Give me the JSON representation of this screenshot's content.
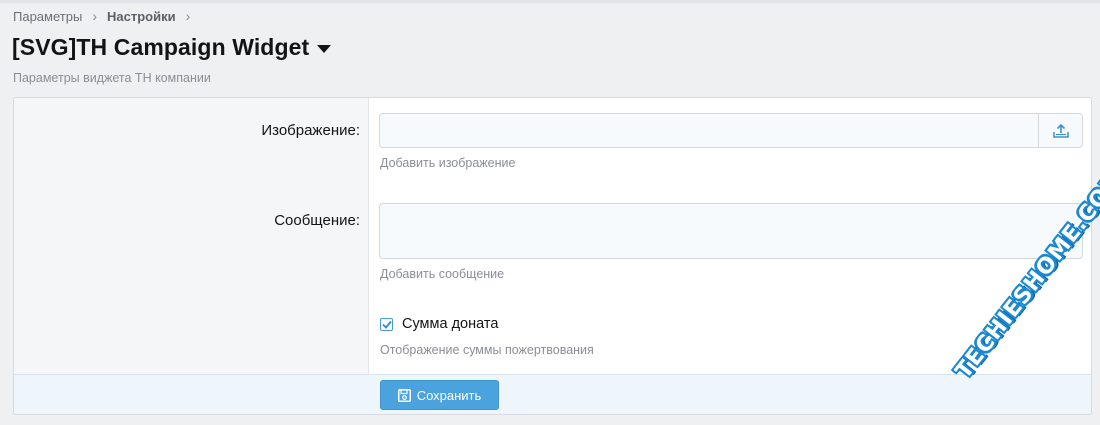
{
  "breadcrumb": {
    "items": [
      {
        "label": "Параметры"
      },
      {
        "label": "Настройки"
      }
    ]
  },
  "header": {
    "title": "[SVG]TH Campaign Widget",
    "description": "Параметры виджета TH компании"
  },
  "form": {
    "image": {
      "label": "Изображение:",
      "value": "",
      "hint": "Добавить изображение"
    },
    "message": {
      "label": "Сообщение:",
      "value": "",
      "hint": "Добавить сообщение"
    },
    "donation_sum": {
      "label": "Сумма доната",
      "checked": true,
      "hint": "Отображение суммы пожертвования"
    },
    "save_label": "Сохранить"
  },
  "watermark": {
    "text": "TECHIESHOME.COM"
  },
  "colors": {
    "accent": "#4aa3df",
    "page_bg": "#eff0f2",
    "watermark_blue": "#1b88d3"
  },
  "icons": {
    "breadcrumb_separator": "chevron-right-icon",
    "title_dropdown": "caret-down-icon",
    "upload": "upload-icon",
    "checkbox": "check-icon",
    "save": "floppy-disk-icon"
  }
}
